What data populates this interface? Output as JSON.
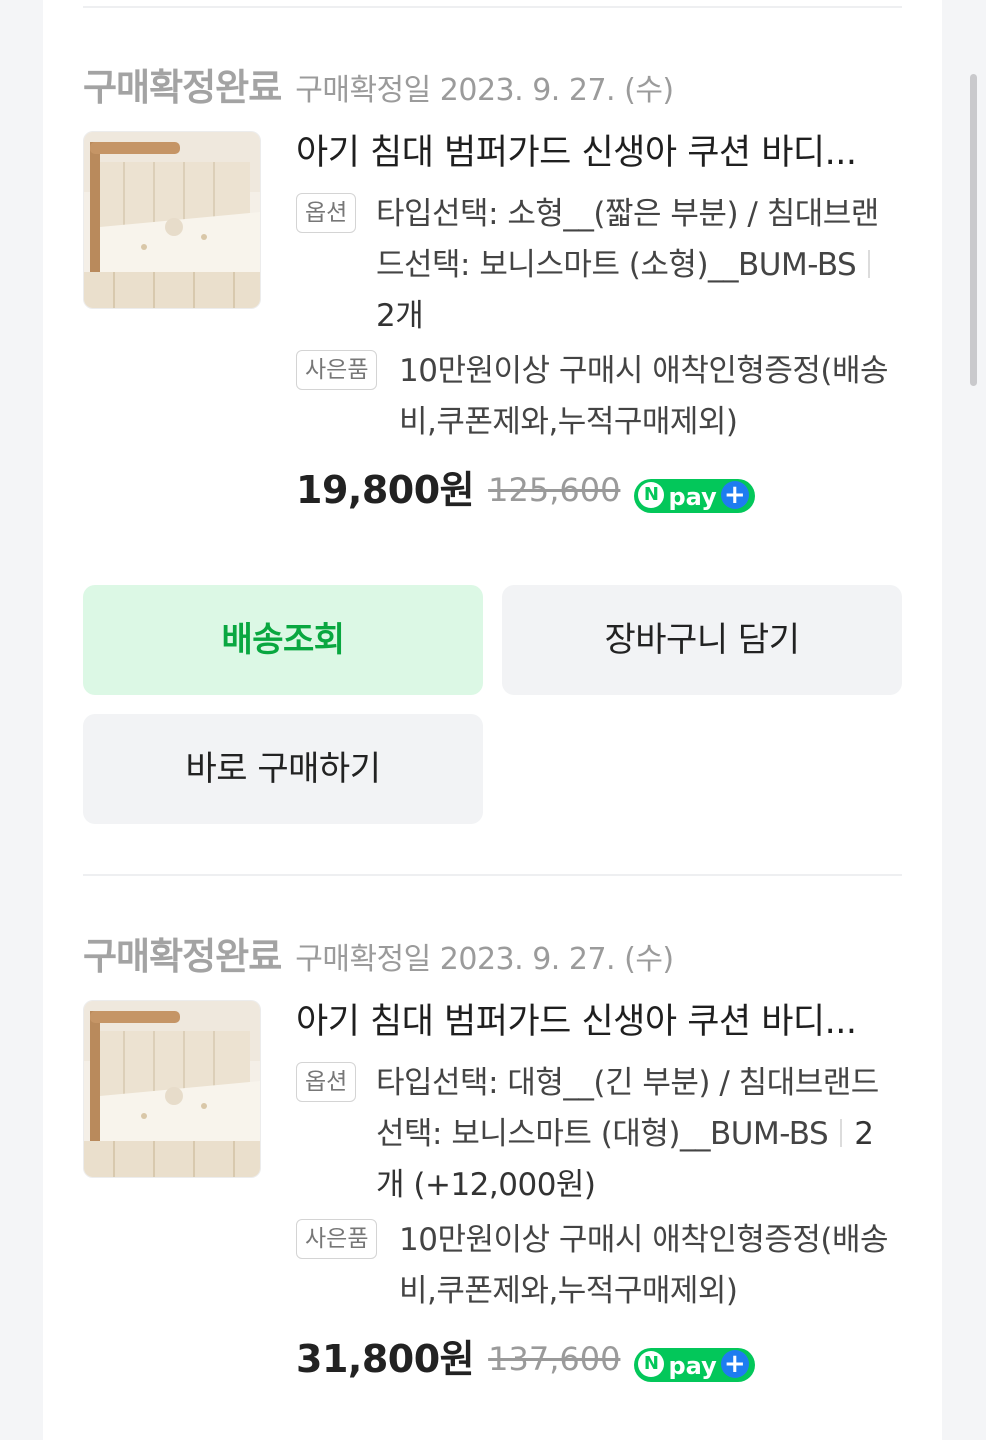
{
  "orders": [
    {
      "status": "구매확정완료",
      "date": "구매확정일 2023. 9. 27. (수)",
      "title": "아기 침대 범퍼가드 신생아 쿠션 바디...",
      "option_tag": "옵션",
      "option_text": "타입선택: 소형__(짧은 부분) / 침대브랜드선택: 보니스마트 (소형)__BUM-BS",
      "quantity": "2개",
      "gift_tag": "사은품",
      "gift_text": "10만원이상 구매시 애착인형증정(배송비,쿠폰제와,누적구매제외)",
      "price": "19,800원",
      "original_price": "125,600",
      "npay_label": "pay",
      "buttons": {
        "track": "배송조회",
        "cart": "장바구니 담기",
        "buy": "바로 구매하기"
      }
    },
    {
      "status": "구매확정완료",
      "date": "구매확정일 2023. 9. 27. (수)",
      "title": "아기 침대 범퍼가드 신생아 쿠션 바디...",
      "option_tag": "옵션",
      "option_text": "타입선택: 대형__(긴 부분) / 침대브랜드선택: 보니스마트 (대형)__BUM-BS",
      "quantity": "2개 (+12,000원)",
      "gift_tag": "사은품",
      "gift_text": "10만원이상 구매시 애착인형증정(배송비,쿠폰제와,누적구매제외)",
      "price": "31,800원",
      "original_price": "137,600",
      "npay_label": "pay"
    }
  ],
  "colors": {
    "accent_green": "#09a740",
    "npay_green": "#03c75a",
    "npay_plus": "#1e7cf0"
  },
  "icons": {
    "npay": "npay-plus-badge"
  }
}
